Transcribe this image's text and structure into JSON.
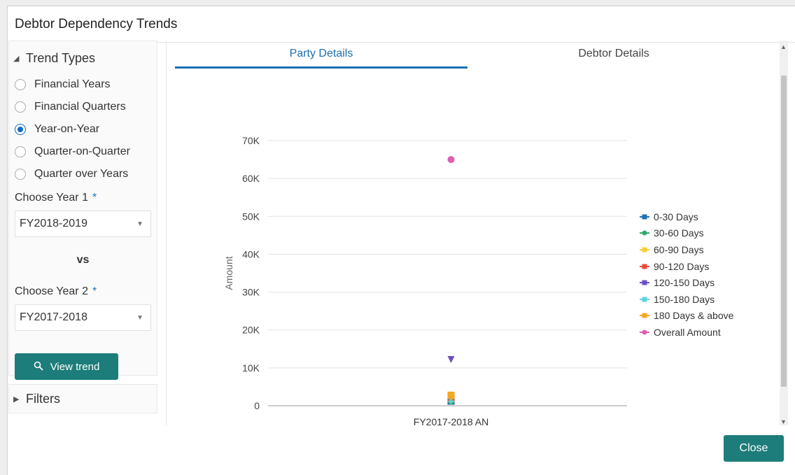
{
  "dialog": {
    "title": "Debtor Dependency Trends"
  },
  "trend": {
    "header": "Trend Types",
    "options": [
      {
        "label": "Financial Years",
        "selected": false
      },
      {
        "label": "Financial Quarters",
        "selected": false
      },
      {
        "label": "Year-on-Year",
        "selected": true
      },
      {
        "label": "Quarter-on-Quarter",
        "selected": false
      },
      {
        "label": "Quarter over Years",
        "selected": false
      }
    ],
    "year1_label": "Choose Year 1",
    "year1_value": "FY2018-2019",
    "vs": "vs",
    "year2_label": "Choose Year 2",
    "year2_value": "FY2017-2018",
    "required_mark": "*",
    "view_button": "View trend"
  },
  "filters": {
    "header": "Filters"
  },
  "tabs": [
    {
      "label": "Party Details",
      "active": true
    },
    {
      "label": "Debtor Details",
      "active": false
    }
  ],
  "footer": {
    "close_button": "Close"
  },
  "chart_data": {
    "type": "scatter",
    "categories": [
      "FY2017-2018 AN"
    ],
    "ylabel": "Amount",
    "ylim": [
      0,
      70000
    ],
    "yticks": [
      "0",
      "10K",
      "20K",
      "30K",
      "40K",
      "50K",
      "60K",
      "70K"
    ],
    "grid": true,
    "legend_position": "right",
    "series": [
      {
        "name": "0-30 Days",
        "values": [
          1200
        ],
        "color": "#1f6fb5",
        "marker": "square"
      },
      {
        "name": "30-60 Days",
        "values": [
          1300
        ],
        "color": "#2eaa6b",
        "marker": "circle"
      },
      {
        "name": "60-90 Days",
        "values": [
          1400
        ],
        "color": "#f4d03f",
        "marker": "diamond"
      },
      {
        "name": "90-120 Days",
        "values": [
          1500
        ],
        "color": "#e74c3c",
        "marker": "cross"
      },
      {
        "name": "120-150 Days",
        "values": [
          12200
        ],
        "color": "#6c4fc4",
        "marker": "triangle-down"
      },
      {
        "name": "150-180 Days",
        "values": [
          1200
        ],
        "color": "#5fd3e0",
        "marker": "star"
      },
      {
        "name": "180 Days & above",
        "values": [
          2800
        ],
        "color": "#f5a623",
        "marker": "square"
      },
      {
        "name": "Overall Amount",
        "values": [
          65000
        ],
        "color": "#e05fb3",
        "marker": "circle"
      }
    ]
  }
}
